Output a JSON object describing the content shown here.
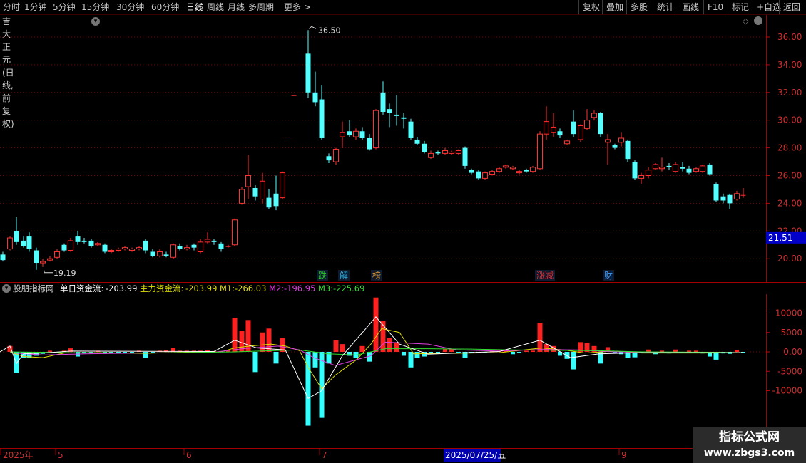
{
  "toolbar": {
    "periods": [
      "分时",
      "1分钟",
      "5分钟",
      "15分钟",
      "30分钟",
      "60分钟",
      "日线",
      "周线",
      "月线",
      "多周期",
      "更多"
    ],
    "more_arrow": ">",
    "active": "日线",
    "right_buttons": [
      "复权",
      "叠加",
      "多股",
      "统计",
      "画线",
      "F10",
      "标记",
      "+自选",
      "返回"
    ]
  },
  "stock": {
    "title": "吉大正元(日线,前复权)"
  },
  "price_axis": {
    "labels": [
      "36.00",
      "34.00",
      "32.00",
      "30.00",
      "28.00",
      "26.00",
      "24.00",
      "22.00",
      "20.00"
    ],
    "current_price": "21.51",
    "high_label": "36.50",
    "low_label": "19.19"
  },
  "event_tags": [
    {
      "text": "跌",
      "color": "#20d020"
    },
    {
      "text": "解",
      "color": "#30b0e0"
    },
    {
      "text": "榜",
      "color": "#e0a040"
    },
    {
      "text": "涨减",
      "color": "#e03030"
    },
    {
      "text": "财",
      "color": "#40a0ff"
    }
  ],
  "indicator": {
    "name": "股朋指标网",
    "single_label": "单日资金流:",
    "single_value": "-203.99",
    "main_label": "主力资金流:",
    "main_value": "-203.99",
    "m1_label": "M1:",
    "m1_value": "-266.03",
    "m2_label": "M2:",
    "m2_value": "-196.95",
    "m3_label": "M3:",
    "m3_value": "-225.69",
    "axis_labels": [
      "10000",
      "5000",
      "0.00",
      "-5000",
      "-10000"
    ],
    "colors": {
      "single": "#ffffff",
      "main": "#e0e000",
      "m1": "#e0e000",
      "m2": "#e040e0",
      "m3": "#30e030"
    }
  },
  "date_axis": {
    "labels": [
      "2025年",
      "5",
      "6",
      "7",
      "9"
    ],
    "highlight": "2025/07/25/五"
  },
  "watermark": {
    "line1": "指标公式网",
    "line2": "www.zbgs3.com"
  }
}
